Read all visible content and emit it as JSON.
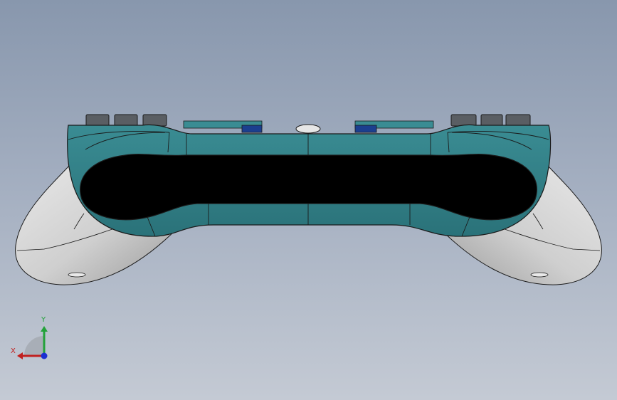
{
  "viewport": {
    "background_top": "#8897ad",
    "background_bottom": "#c4cad4"
  },
  "model": {
    "name": "game-controller",
    "colors": {
      "body_teal": "#2f7f86",
      "body_teal_dark": "#236269",
      "grip_gray": "#cfcfcf",
      "grip_shadow": "#a9a9a9",
      "button_gray": "#5a5e63",
      "accent_blue": "#1b3f8f",
      "opening": "#000000",
      "edge_line": "#1a1a1a"
    }
  },
  "triad": {
    "x_label": "X",
    "y_label": "Y",
    "x_color": "#c0201f",
    "y_color": "#23a23a",
    "z_color": "#1c2fd1"
  }
}
